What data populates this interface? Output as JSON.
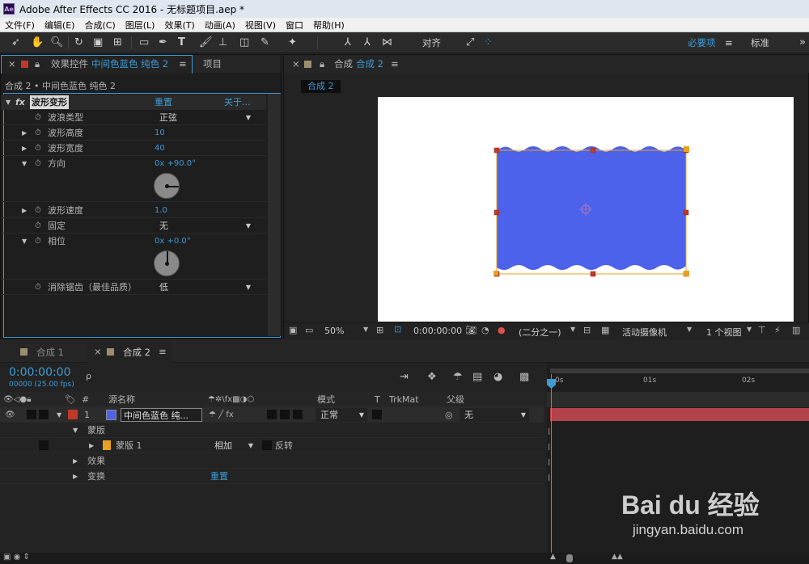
{
  "window": {
    "app_icon": "Ae",
    "title": "Adobe After Effects CC 2016 - 无标题项目.aep *"
  },
  "menu": [
    "文件(F)",
    "编辑(E)",
    "合成(C)",
    "图层(L)",
    "效果(T)",
    "动画(A)",
    "视图(V)",
    "窗口",
    "帮助(H)"
  ],
  "toolbar": {
    "align_label": "对齐",
    "workspace_essentials": "必要项",
    "workspace_standard": "标准",
    "menu_glyph": "≡",
    "more": "»"
  },
  "effects_panel": {
    "tab_label": "效果控件",
    "tab_layer": "中间色蓝色 纯色 2",
    "tab_menu": "≡",
    "project_tab": "项目",
    "breadcrumb": "合成 2 • 中间色蓝色 纯色 2",
    "effect_name": "波形变形",
    "reset": "重置",
    "about": "关于...",
    "props": [
      {
        "label": "波浪类型",
        "value": "正弦"
      },
      {
        "label": "波形高度",
        "value": "10"
      },
      {
        "label": "波形宽度",
        "value": "40"
      },
      {
        "label": "方向",
        "value": "0x +90.0°"
      },
      {
        "label": "波形速度",
        "value": "1.0"
      },
      {
        "label": "固定",
        "value": "无"
      },
      {
        "label": "相位",
        "value": "0x +0.0°"
      },
      {
        "label": "消除锯齿（最佳品质）",
        "value": "低"
      }
    ]
  },
  "comp_panel": {
    "tab_label": "合成",
    "tab_comp": "合成 2",
    "tab_menu": "≡",
    "comp_chip": "合成 2",
    "zoom": "50%",
    "timecode": "0:00:00:00",
    "resolution": "(二分之一)",
    "camera": "活动摄像机",
    "views": "1 个视图"
  },
  "timeline": {
    "tab1": "合成 1",
    "tab2": "合成 2",
    "tab_menu": "≡",
    "timecode": "0:00:00:00",
    "fps": "00000 (25.00 fps)",
    "search_glyph": "ρ",
    "col_source": "源名称",
    "col_mode": "模式",
    "col_t": "T",
    "col_trkmat": "TrkMat",
    "col_parent": "父级",
    "col_num": "#",
    "layer": {
      "num": "1",
      "name": "中间色蓝色 纯...",
      "mode": "正常",
      "parent": "无"
    },
    "mask_group": "蒙版",
    "mask_name": "蒙版 1",
    "mask_mode": "相加",
    "mask_invert": "反转",
    "effects": "效果",
    "transform": "变换",
    "transform_reset": "重置",
    "ruler": [
      "0s",
      "01s",
      "02s"
    ]
  },
  "watermark": {
    "logo": "Bai du 经验",
    "url": "jingyan.baidu.com"
  },
  "colors": {
    "accent": "#3d9bd6",
    "solid": "#4c62ea",
    "track": "#b3434a",
    "label_red": "#c0392b",
    "mask_orange": "#e8a020"
  }
}
